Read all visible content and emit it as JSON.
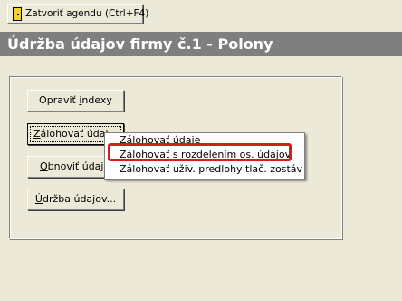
{
  "toolbar": {
    "close_label": "Zatvoriť agendu (Ctrl+F4)",
    "icon": "door-icon"
  },
  "header": {
    "title": "Údržba údajov firmy č.1 - Polony"
  },
  "buttons": {
    "repair_pre": "Opraviť ",
    "repair_accel": "i",
    "repair_post": "ndexy",
    "backup_accel": "Z",
    "backup_post": "álohovať údaj",
    "restore_accel": "O",
    "restore_post": "bnoviť údaje",
    "maintenance_accel": "Ú",
    "maintenance_post": "držba údajov..."
  },
  "context_menu": {
    "items": [
      "Zálohovať údaje",
      "Zálohovať s rozdelením os. údajov",
      "Zálohovať uživ. predlohy tlač. zostáv"
    ],
    "highlighted_index": 1,
    "highlight_color": "#d81b1b"
  },
  "colors": {
    "header_bg": "#7f7f7f",
    "window_bg": "#ece9d8"
  }
}
